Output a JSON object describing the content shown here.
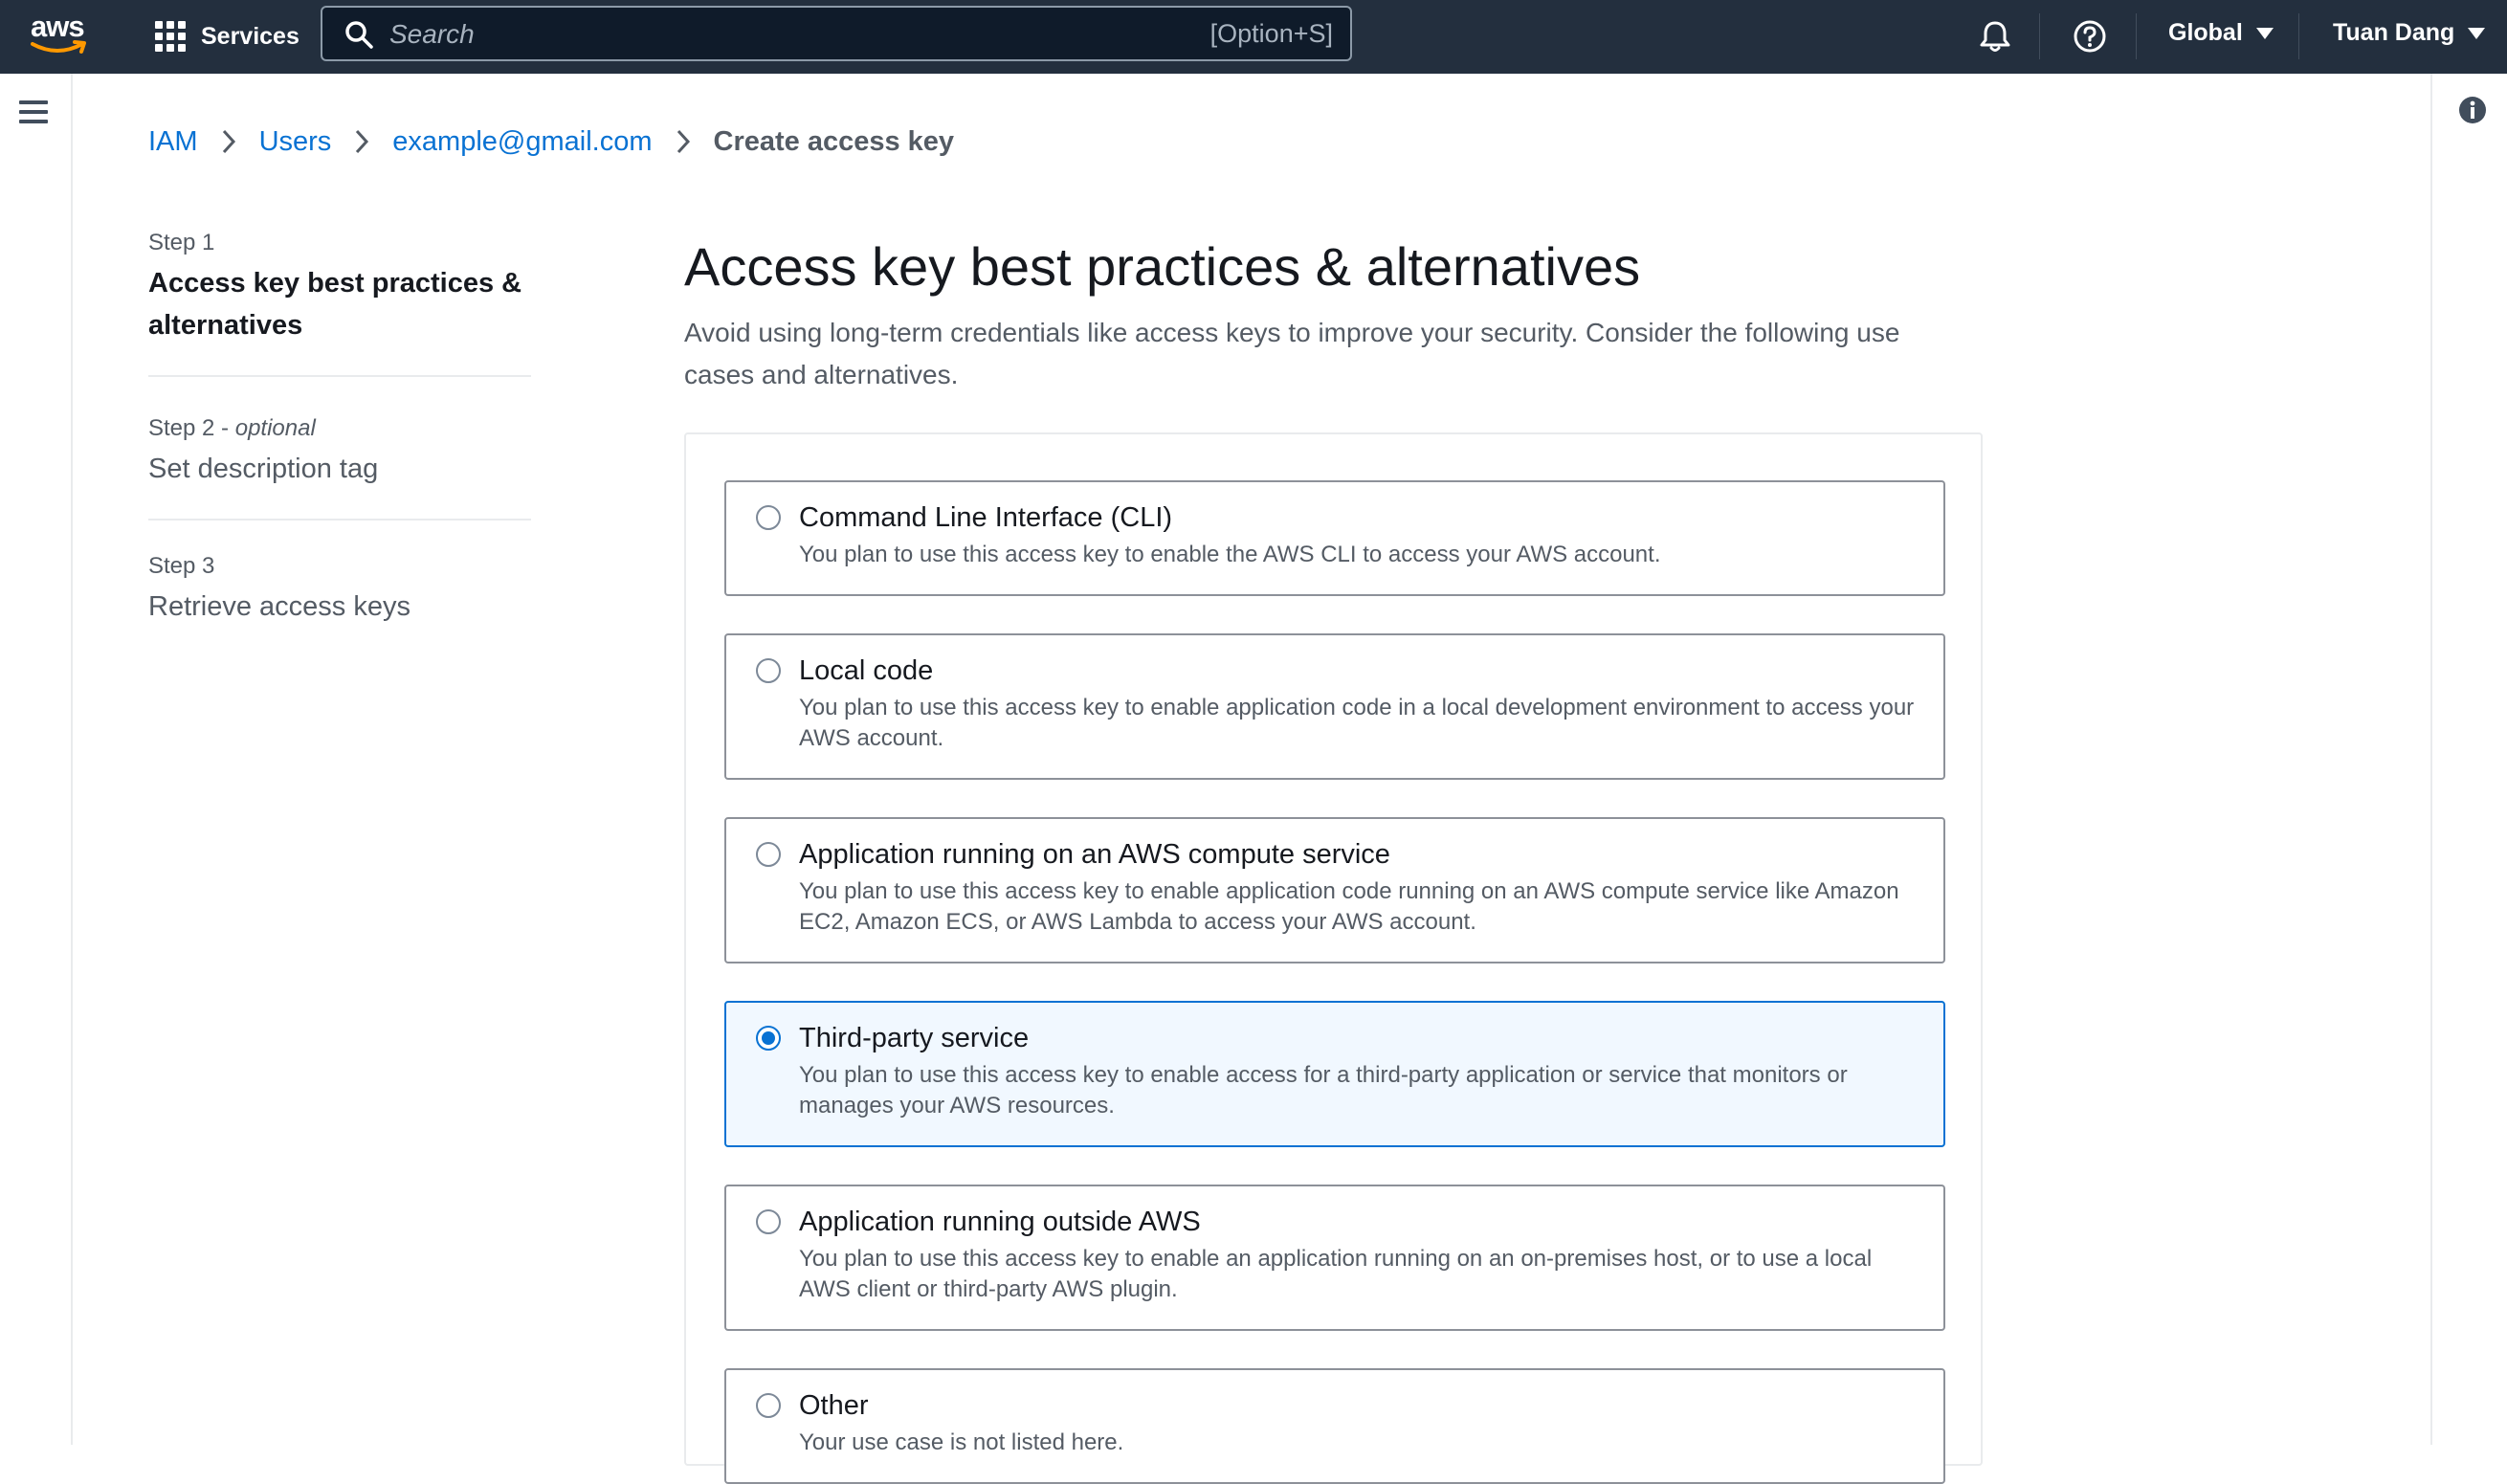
{
  "topnav": {
    "logo_text": "aws",
    "services_label": "Services",
    "search_placeholder": "Search",
    "search_shortcut": "[Option+S]",
    "region_label": "Global",
    "account_label": "Tuan Dang"
  },
  "breadcrumb": {
    "items": [
      "IAM",
      "Users",
      "example@gmail.com"
    ],
    "current": "Create access key"
  },
  "steps": [
    {
      "number": "Step 1",
      "optional": "",
      "title": "Access key best practices & alternatives"
    },
    {
      "number": "Step 2",
      "optional": "optional",
      "title": "Set description tag"
    },
    {
      "number": "Step 3",
      "optional": "",
      "title": "Retrieve access keys"
    }
  ],
  "main": {
    "title": "Access key best practices & alternatives",
    "description": "Avoid using long-term credentials like access keys to improve your security. Consider the following use cases and alternatives."
  },
  "options": [
    {
      "title": "Command Line Interface (CLI)",
      "description": "You plan to use this access key to enable the AWS CLI to access your AWS account.",
      "selected": false
    },
    {
      "title": "Local code",
      "description": "You plan to use this access key to enable application code in a local development environment to access your AWS account.",
      "selected": false
    },
    {
      "title": "Application running on an AWS compute service",
      "description": "You plan to use this access key to enable application code running on an AWS compute service like Amazon EC2, Amazon ECS, or AWS Lambda to access your AWS account.",
      "selected": false
    },
    {
      "title": "Third-party service",
      "description": "You plan to use this access key to enable access for a third-party application or service that monitors or manages your AWS resources.",
      "selected": true
    },
    {
      "title": "Application running outside AWS",
      "description": "You plan to use this access key to enable an application running on an on-premises host, or to use a local AWS client or third-party AWS plugin.",
      "selected": false
    },
    {
      "title": "Other",
      "description": "Your use case is not listed here.",
      "selected": false
    }
  ],
  "colors": {
    "nav_background": "#232f3e",
    "link": "#0972d3",
    "selected_background": "#f1f8ff",
    "aws_smile": "#ff9900"
  }
}
